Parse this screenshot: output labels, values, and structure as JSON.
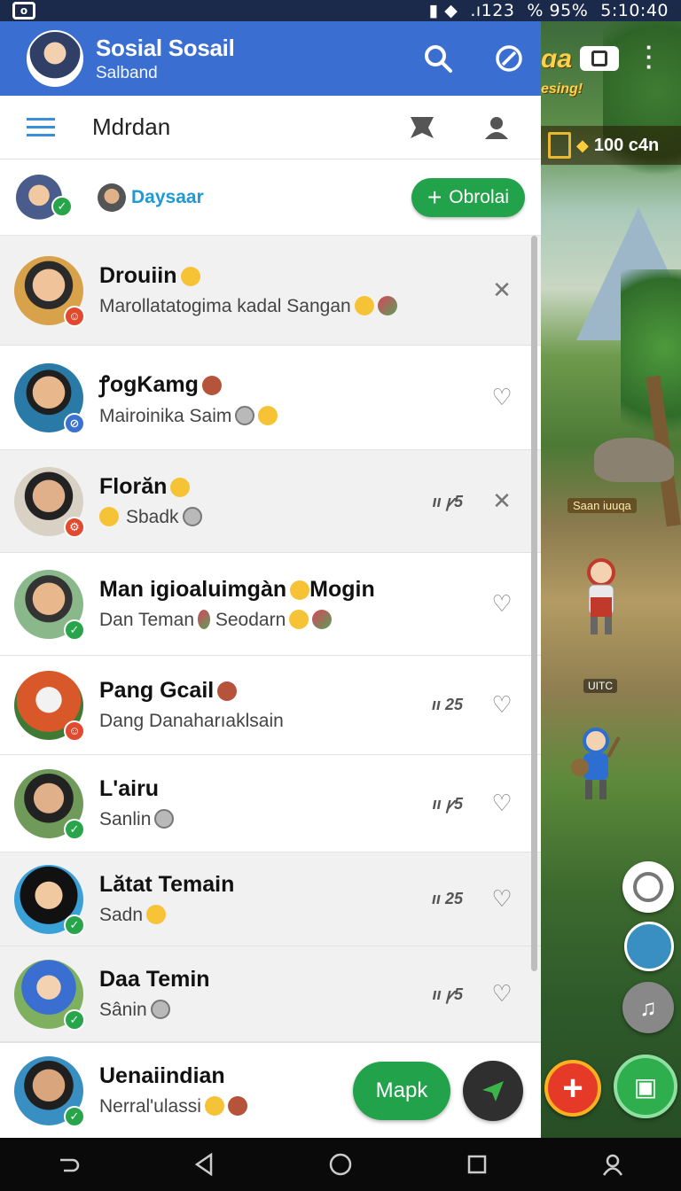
{
  "status_bar": {
    "network": ".ı123",
    "battery": "% 95%",
    "time": "5:10:40"
  },
  "app_bar": {
    "title": "Sosial Sosail",
    "subtitle": "Salband"
  },
  "toolbar": {
    "title": "Mdrdan"
  },
  "online_strip": {
    "friend_name": "Daysaar",
    "chat_button_label": "Obrolai"
  },
  "chats": [
    {
      "name": "Drouiin",
      "message": "Marollatatogima kadal Sangan",
      "meta": "",
      "action": "close",
      "badge": "red",
      "selected": true
    },
    {
      "name": "ꝭogKamg",
      "message": "Mairoinika Saim",
      "meta": "",
      "action": "heart",
      "badge": "blue",
      "selected": false
    },
    {
      "name": "Florăn",
      "message": "Sbadk",
      "meta": "ıı ꝩ5",
      "action": "close",
      "badge": "red",
      "selected": true
    },
    {
      "name": "Man igioaluimgàn",
      "name_suffix": "Mogin",
      "message": "Dan Teman",
      "message_suffix": "Seodarn",
      "meta": "",
      "action": "heart",
      "badge": "green",
      "selected": false
    },
    {
      "name": "Pang Gcail",
      "message": "Dang Danaharıaklsain",
      "meta": "ıı 25",
      "action": "heart",
      "badge": "red",
      "selected": false
    },
    {
      "name": "L'airu",
      "message": "Sanlin",
      "meta": "ıı ꝩ5",
      "action": "heart",
      "badge": "green",
      "selected": false
    },
    {
      "name": "Lătat Temain",
      "message": "Sadn",
      "meta": "ıı 25",
      "action": "heart",
      "badge": "green",
      "selected": false
    },
    {
      "name": "Daa Temin",
      "message": "Sânin",
      "meta": "ıı ꝩ5",
      "action": "heart",
      "badge": "green",
      "selected": false
    }
  ],
  "bottom_chat": {
    "name": "Uenaiindian",
    "message": "Nerral'ulassi",
    "map_label": "Mapk"
  },
  "game": {
    "title": "ɑa",
    "subtitle": "esing!",
    "coins": "100 c4n",
    "sign1": "Saan iuuqa",
    "sign2": "UITC"
  },
  "colors": {
    "app_bar": "#3a6fd1",
    "accent_green": "#22a24a",
    "link_blue": "#1e9ad6"
  }
}
